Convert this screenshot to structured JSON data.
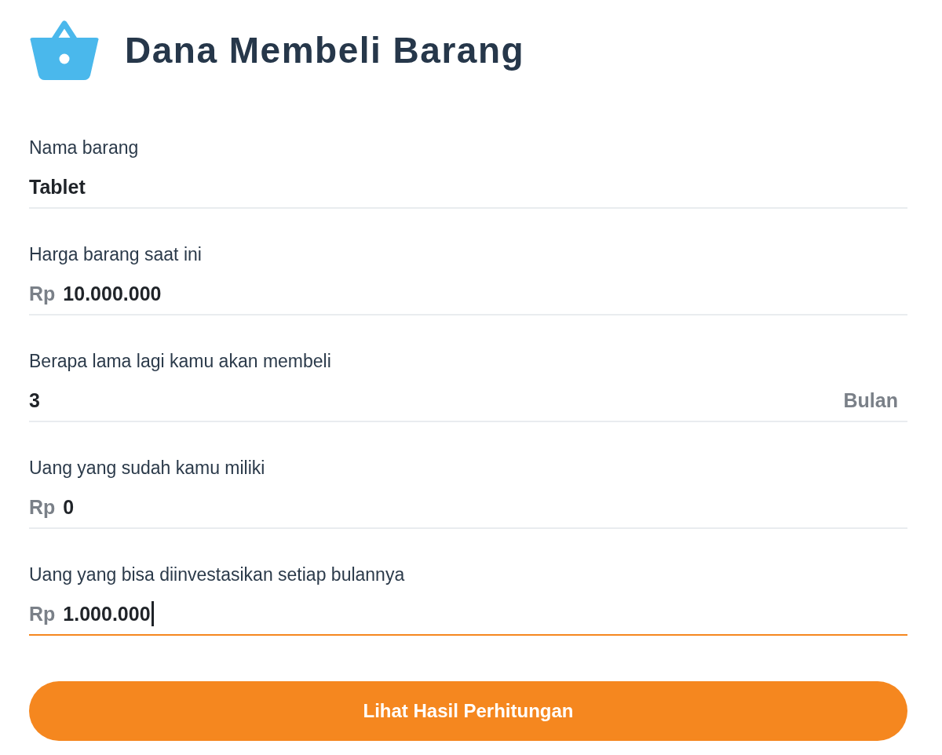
{
  "header": {
    "title": "Dana Membeli Barang"
  },
  "fields": [
    {
      "label": "Nama barang",
      "value": "Tablet",
      "focused": false
    },
    {
      "label": "Harga barang saat ini",
      "prefix": "Rp",
      "value": "10.000.000",
      "focused": false
    },
    {
      "label": "Berapa lama lagi kamu akan membeli",
      "value": "3",
      "suffix": "Bulan",
      "focused": false
    },
    {
      "label": "Uang yang sudah kamu miliki",
      "prefix": "Rp",
      "value": "0",
      "focused": false
    },
    {
      "label": "Uang yang bisa diinvestasikan setiap bulannya",
      "prefix": "Rp",
      "value": "1.000.000",
      "focused": true
    }
  ],
  "submit_button": {
    "label": "Lihat Hasil Perhitungan"
  }
}
